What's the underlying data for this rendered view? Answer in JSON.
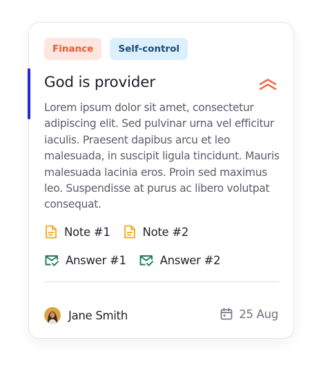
{
  "card": {
    "tags": [
      {
        "label": "Finance",
        "color": "#ea5a31",
        "background": "#fde6df"
      },
      {
        "label": "Self-control",
        "color": "#1e4c78",
        "background": "#dbeffd"
      }
    ],
    "title": "God is provider",
    "priority_icon": "double-chevron-up-icon",
    "priority_color": "#ef6a4a",
    "accent_color": "#2326d8",
    "description": "Lorem ipsum dolor sit amet, consectetur adipiscing elit. Sed pulvinar urna vel efficitur iaculis. Praesent dapibus arcu et leo malesuada, in suscipit ligula tincidunt. Mauris malesuada lacinia eros. Proin sed maximus leo. Suspendisse at purus ac libero volutpat consequat.",
    "notes": [
      {
        "label": "Note #1",
        "icon": "document-icon"
      },
      {
        "label": "Note #2",
        "icon": "document-icon"
      }
    ],
    "answers": [
      {
        "label": "Answer #1",
        "icon": "mail-check-icon"
      },
      {
        "label": "Answer #2",
        "icon": "mail-check-icon"
      }
    ],
    "footer": {
      "user_name": "Jane Smith",
      "date": "25 Aug",
      "date_icon": "calendar-icon"
    }
  }
}
